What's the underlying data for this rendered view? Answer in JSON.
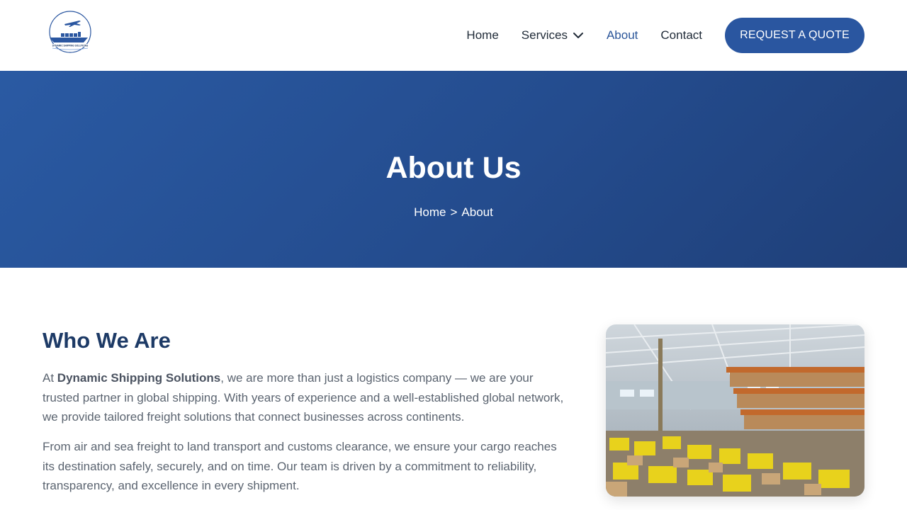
{
  "header": {
    "logo_text": "DYNAMIC SHIPPING SOLUTIONS",
    "nav": {
      "home": "Home",
      "services": "Services",
      "about": "About",
      "contact": "Contact"
    },
    "cta": "REQUEST A QUOTE"
  },
  "hero": {
    "title": "About Us",
    "breadcrumb": {
      "home": "Home",
      "separator": ">",
      "current": "About"
    }
  },
  "who": {
    "title": "Who We Are",
    "p1_prefix": "At ",
    "p1_bold": "Dynamic Shipping Solutions",
    "p1_rest": ", we are more than just a logistics company — we are your trusted partner in global shipping. With years of experience and a well-established global network, we provide tailored freight solutions that connect businesses across continents.",
    "p2": "From air and sea freight to land transport and customs clearance, we ensure your cargo reaches its destination safely, securely, and on time. Our team is driven by a commitment to reliability, transparency, and excellence in every shipment."
  },
  "icons": {
    "logo": "ship-plane-logo",
    "dropdown": "chevron-down-icon",
    "image": "warehouse-photo"
  },
  "colors": {
    "brand": "#2a56a0",
    "hero_start": "#2a5aa3",
    "hero_end": "#1f3f78",
    "heading": "#1d3a66",
    "text": "#5b6470"
  }
}
